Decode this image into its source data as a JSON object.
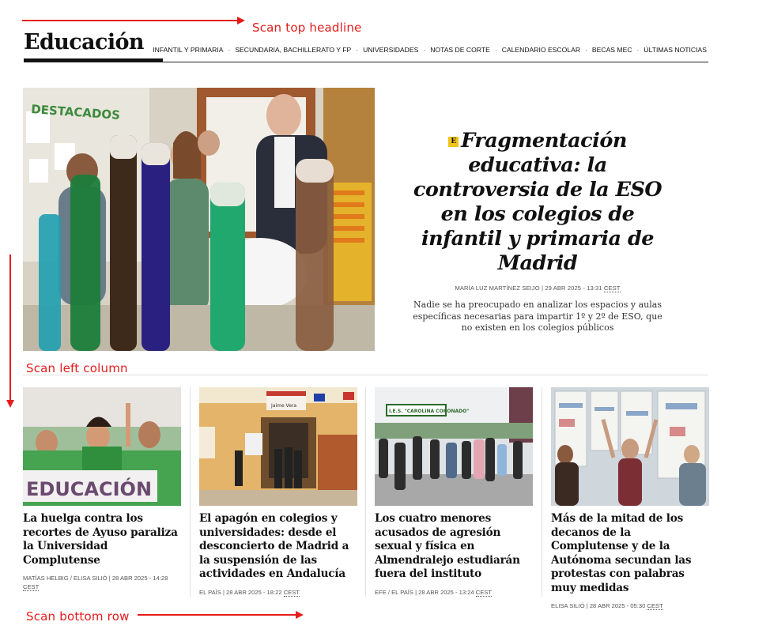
{
  "annotations": {
    "top": "Scan top headline",
    "left": "Scan left column",
    "bottom": "Scan bottom row",
    "color": "#e41c1c"
  },
  "header": {
    "title": "Educación",
    "nav": [
      "INFANTIL Y PRIMARIA",
      "SECUNDARIA, BACHILLERATO Y FP",
      "UNIVERSIDADES",
      "NOTAS DE CORTE",
      "CALENDARIO ESCOLAR",
      "BECAS MEC",
      "ÚLTIMAS NOTICIAS"
    ],
    "separator": "·"
  },
  "hero": {
    "badge": "E",
    "badge_color": "#f0c419",
    "headline": "Fragmentación educativa: la controversia de la ESO en los colegios de infantil y primaria de Madrid",
    "byline": "MARÍA LUZ MARTÍNEZ SEIJO | 29 ABR 2025 - 13:31",
    "tz": "CEST",
    "summary": "Nadie se ha preocupado en analizar los espacios y aulas específicas necesarias para impartir 1º y 2º de ESO, que no existen en los colegios públicos",
    "image_banner_text": "DESTACADOS"
  },
  "cards": [
    {
      "title": "La huelga contra los recortes de Ayuso paraliza la Universidad Complutense",
      "meta": "MATÍAS HELBIG / ELISA SILIÓ | 28 ABR 2025 - 14:28",
      "tz": "CEST",
      "image_text": "EDUCACIÓN"
    },
    {
      "title": "El apagón en colegios y universidades: desde el desconcierto de Madrid a la suspensión de las actividades en Andalucía",
      "meta": "EL PAÍS | 28 ABR 2025 - 18:22",
      "tz": "CEST",
      "image_text": "Jaime Vera"
    },
    {
      "title": "Los cuatro menores acusados de agresión sexual y física en Almendralejo estudiarán fuera del instituto",
      "meta": "EFE / EL PAÍS | 28 ABR 2025 - 13:24",
      "tz": "CEST",
      "image_text": "I.E.S. \"CAROLINA CORONADO\""
    },
    {
      "title": "Más de la mitad de los decanos de la Complutense y de la Autónoma secundan las protestas con palabras muy medidas",
      "meta": "ELISA SILIÓ | 28 ABR 2025 - 05:30",
      "tz": "CEST",
      "image_text": ""
    }
  ]
}
